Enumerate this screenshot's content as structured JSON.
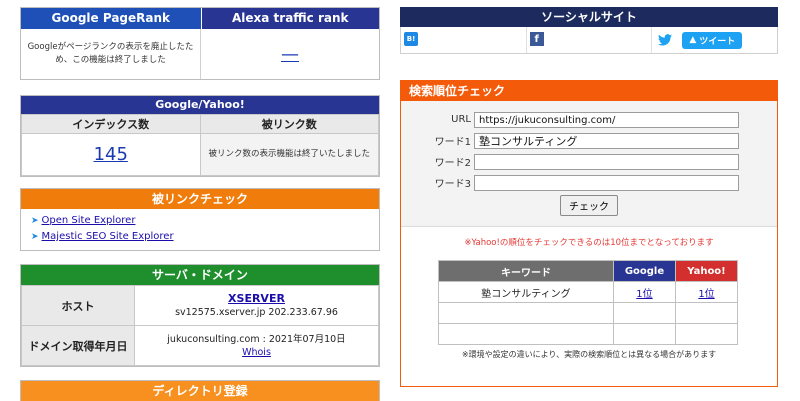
{
  "pagerank": {
    "col1_title": "Google PageRank",
    "col2_title": "Alexa traffic rank",
    "pagerank_note": "Googleがページランクの表示を廃止したため、この機能は終了しました",
    "alexa_value": "—"
  },
  "google_yahoo": {
    "title": "Google/Yahoo!",
    "index_label": "インデックス数",
    "backlink_label": "被リンク数",
    "index_value": "145",
    "backlink_note": "被リンク数の表示機能は終了いたしました"
  },
  "backlink_check": {
    "title": "被リンクチェック",
    "links": [
      "Open Site Explorer",
      "Majestic SEO Site Explorer"
    ]
  },
  "server_domain": {
    "title": "サーバ・ドメイン",
    "host_label": "ホスト",
    "host_name": "XSERVER",
    "host_detail": "sv12575.xserver.jp 202.233.67.96",
    "domain_label": "ドメイン取得年月日",
    "domain_date": "jukuconsulting.com : 2021年07月10日",
    "whois_link": "Whois"
  },
  "directory": {
    "title": "ディレクトリ登録"
  },
  "social": {
    "title": "ソーシャルサイト",
    "hatena_icon_text": "B!",
    "facebook_icon_text": "f",
    "tweet_label": "ツイート",
    "colors": {
      "hatena": "#1e88e5",
      "facebook": "#3b5998",
      "twitter": "#1da1f2"
    }
  },
  "rank_check": {
    "title": "検索順位チェック",
    "url_label": "URL",
    "url_value": "https://jukuconsulting.com/",
    "word1_label": "ワード1",
    "word1_value": "塾コンサルティング",
    "word2_label": "ワード2",
    "word2_value": "",
    "word3_label": "ワード3",
    "word3_value": "",
    "check_button": "チェック",
    "notice": "※Yahoo!の順位をチェックできるのは10位までとなっております",
    "table": {
      "keyword_header": "キーワード",
      "google_header": "Google",
      "yahoo_header": "Yahoo!",
      "rows": [
        {
          "keyword": "塾コンサルティング",
          "google": "1位",
          "yahoo": "1位"
        },
        {
          "keyword": "",
          "google": "",
          "yahoo": ""
        },
        {
          "keyword": "",
          "google": "",
          "yahoo": ""
        }
      ]
    },
    "footnote": "※環境や設定の違いにより、実際の検索順位とは異なる場合があります"
  }
}
